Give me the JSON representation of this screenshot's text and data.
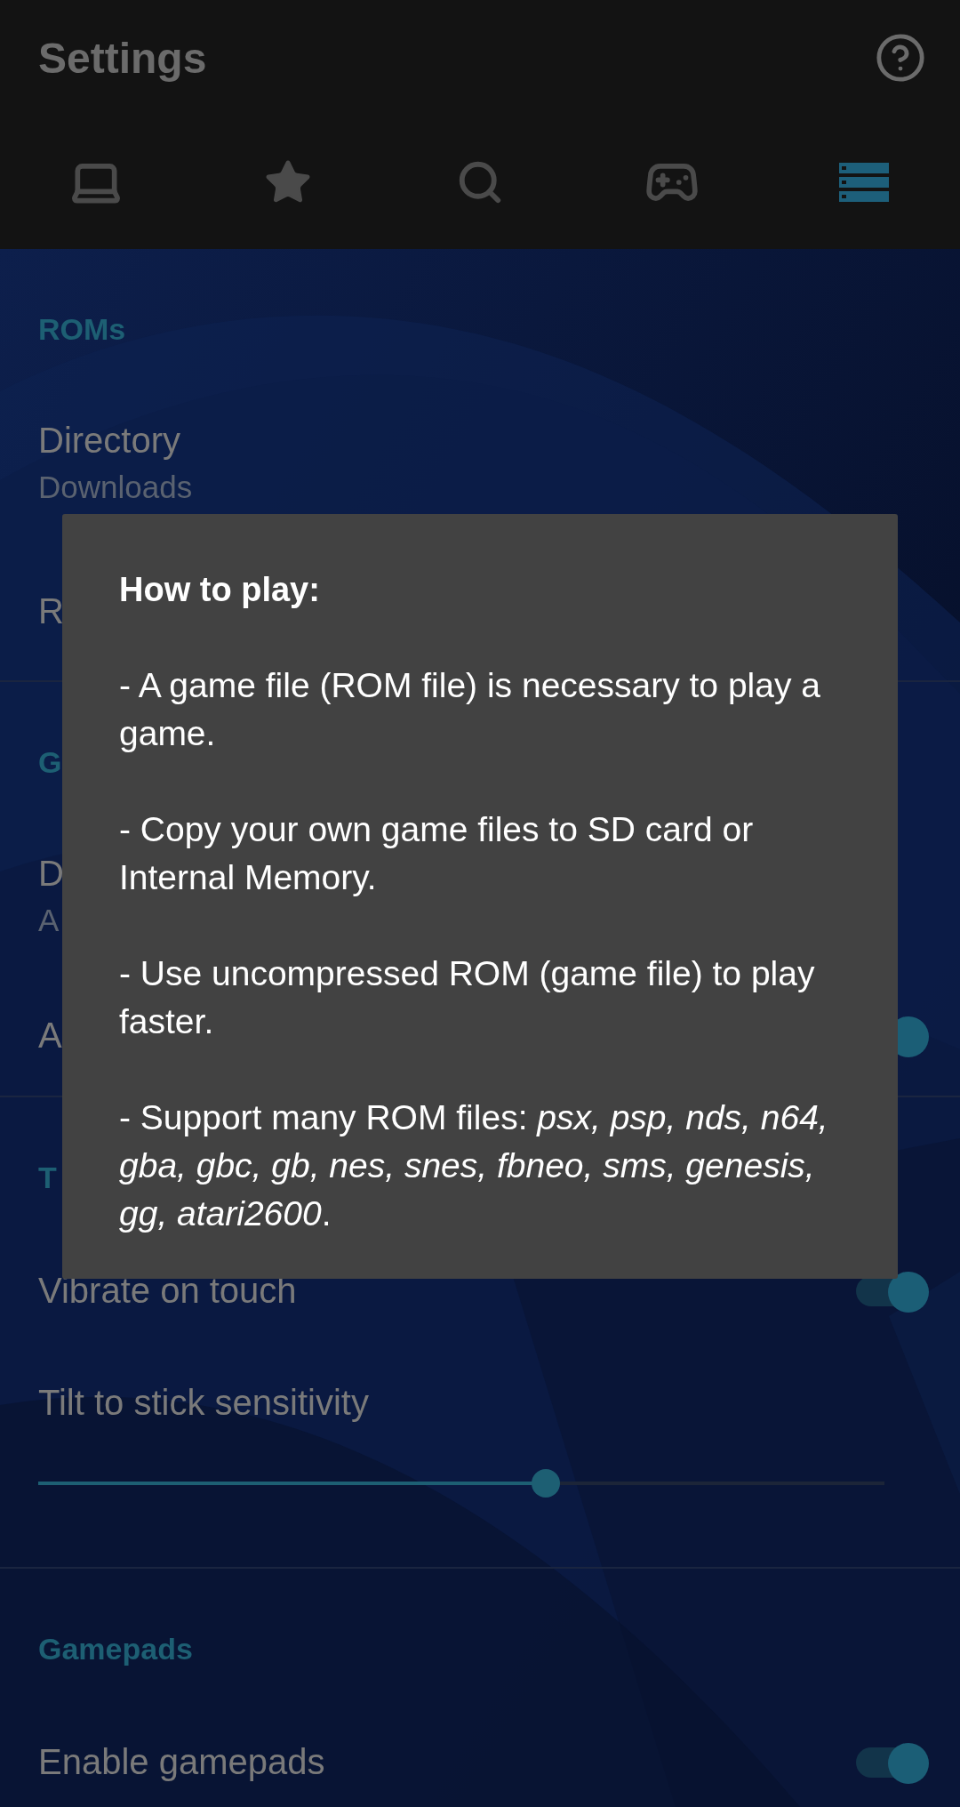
{
  "app_bar": {
    "title": "Settings"
  },
  "tabs": [
    {
      "selected": false
    },
    {
      "selected": false
    },
    {
      "selected": false
    },
    {
      "selected": false
    },
    {
      "selected": true
    }
  ],
  "sections": [
    {
      "header": "ROMs",
      "items": [
        {
          "kind": "text",
          "title": "Directory",
          "subtitle": "Downloads"
        },
        {
          "kind": "text",
          "title": "R"
        }
      ]
    },
    {
      "header": "G",
      "items": [
        {
          "kind": "text",
          "title": "D",
          "subtitle": "A"
        },
        {
          "kind": "toggle",
          "title": "A",
          "on": true
        }
      ]
    },
    {
      "header": "T",
      "items": [
        {
          "kind": "toggle",
          "title": "Vibrate on touch",
          "on": true
        },
        {
          "kind": "slider",
          "title": "Tilt to stick sensitivity",
          "level": 0.6
        }
      ]
    },
    {
      "header": "Gamepads",
      "items": [
        {
          "kind": "toggle",
          "title": "Enable gamepads",
          "on": true
        }
      ]
    }
  ],
  "dialog": {
    "title": "How to play:",
    "paragraphs": [
      "- A game file (ROM file) is necessary to play a game.",
      "- Copy your own game files to SD card or Internal Memory.",
      "- Use uncompressed ROM (game file) to play faster.",
      "- Support many ROM files: *psx, psp, nds, n64, gba, gbc, gb, nes, snes, fbneo, sms, genesis, gg, atari2600*."
    ]
  }
}
